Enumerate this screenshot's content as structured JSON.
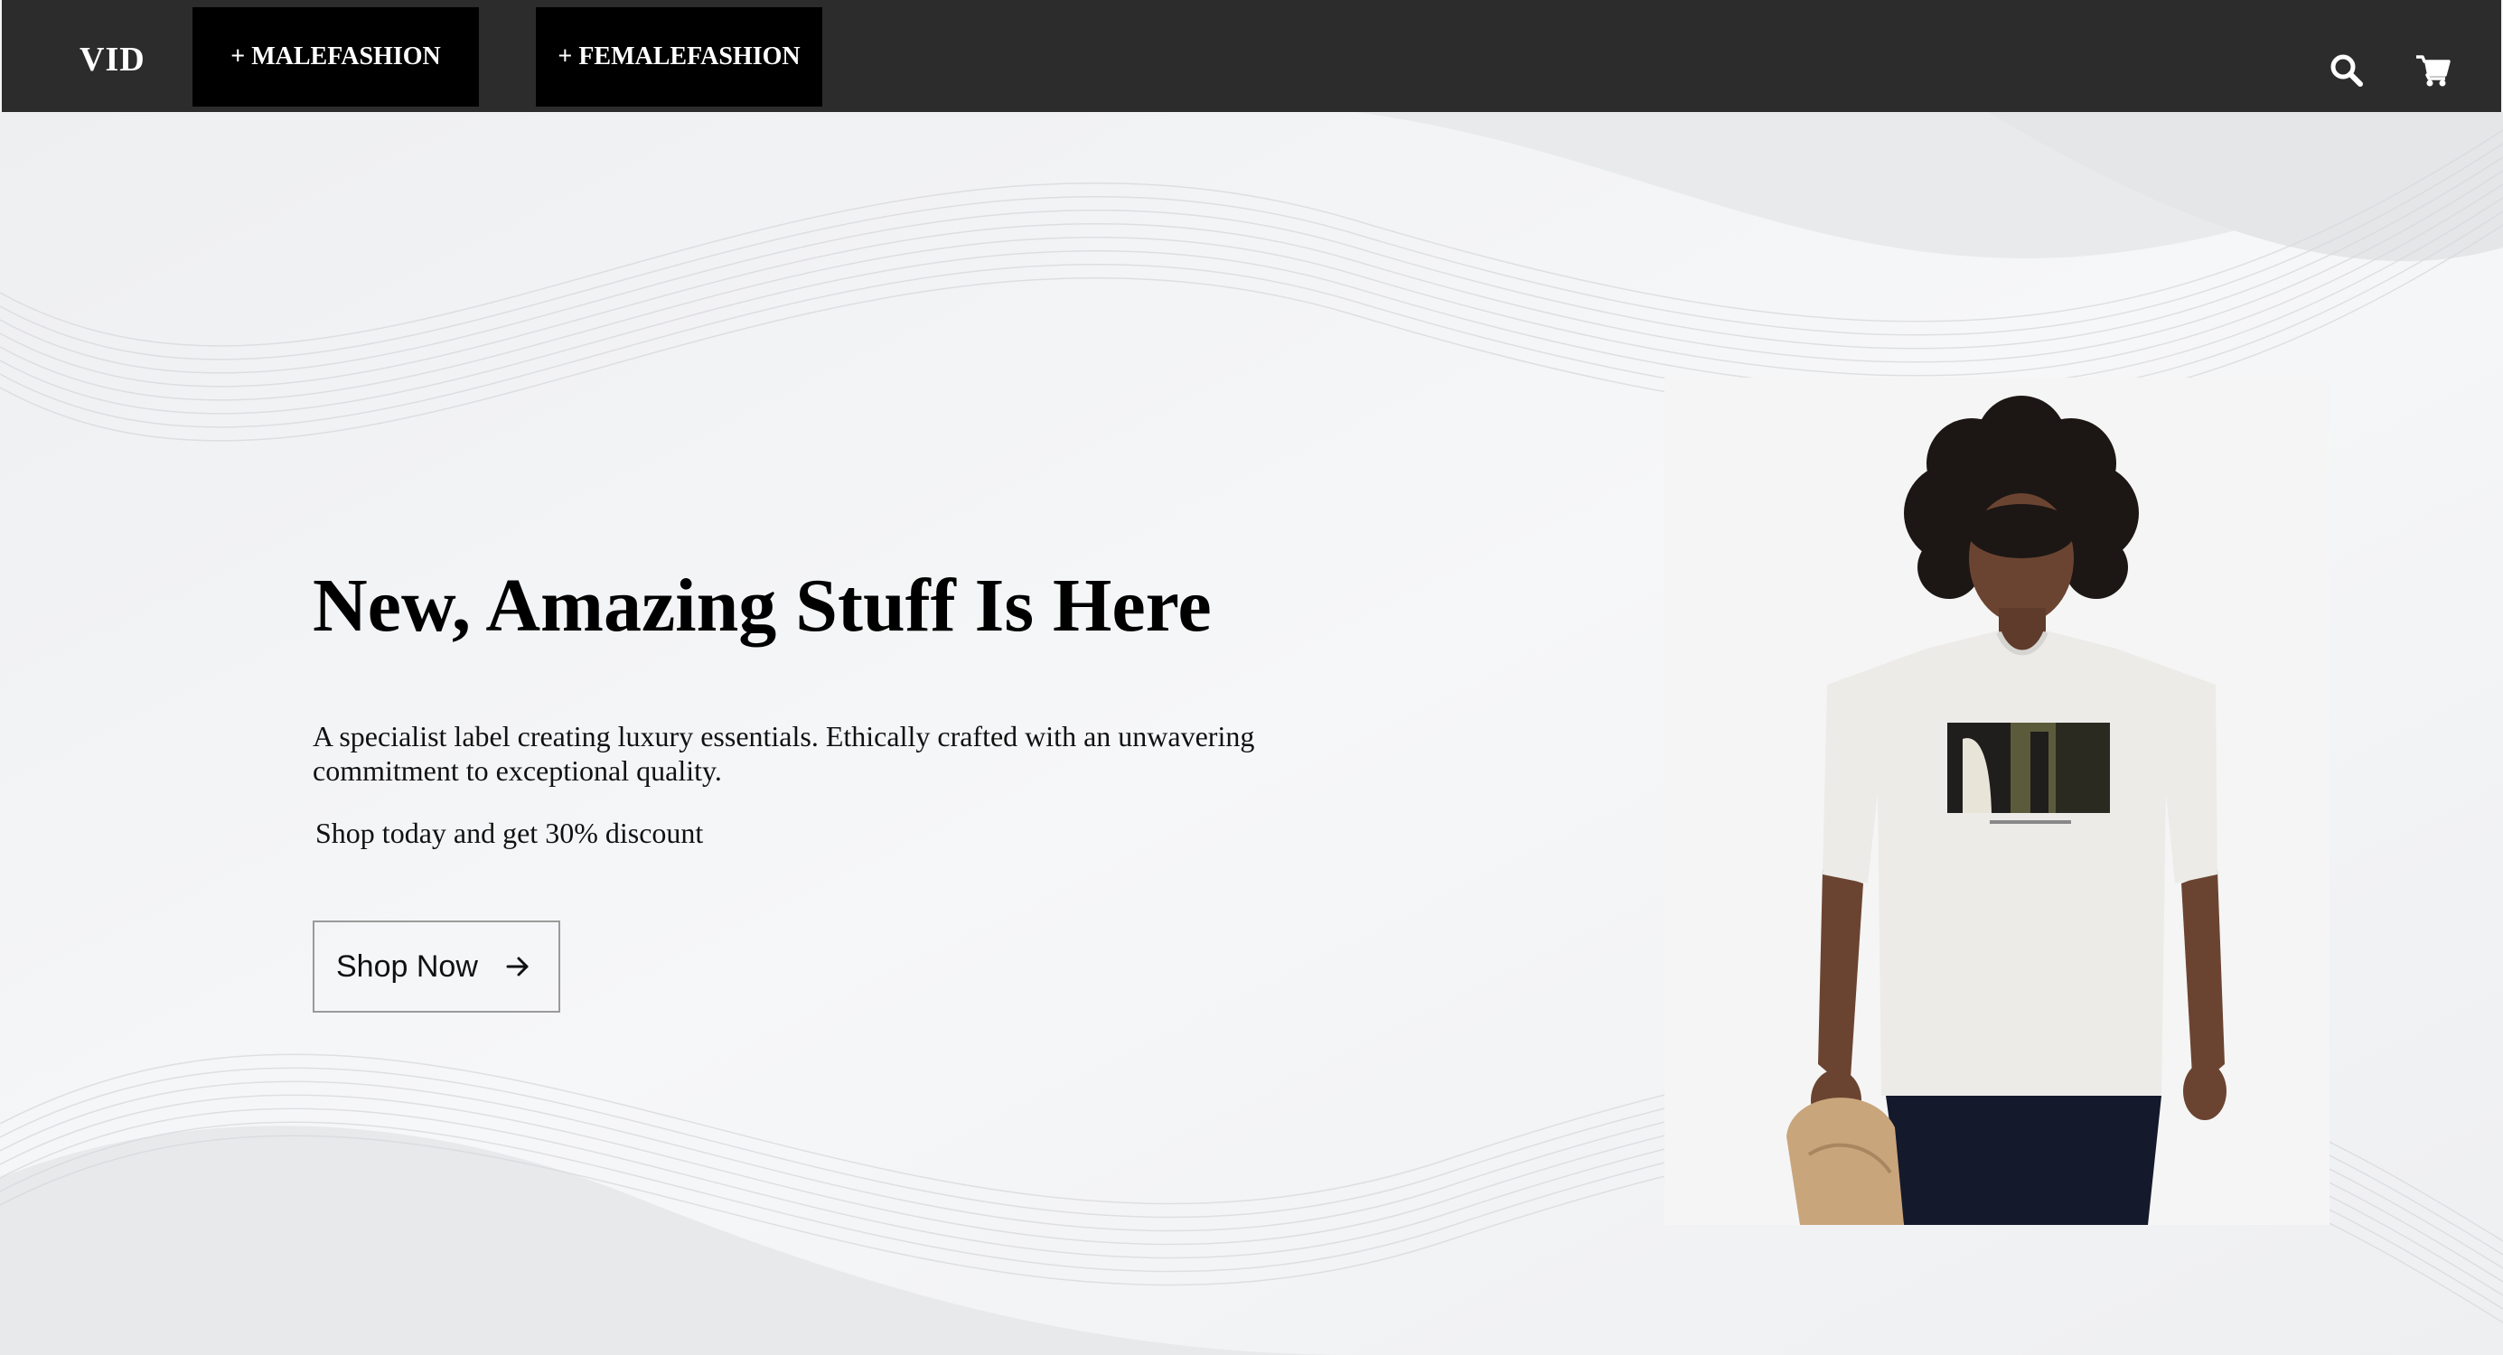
{
  "nav": {
    "logo": "VID",
    "links": [
      {
        "label": "+ MALEFASHION"
      },
      {
        "label": "+ FEMALEFASHION"
      }
    ],
    "icons": [
      "search-icon",
      "cart-icon"
    ]
  },
  "hero": {
    "headline": "New, Amazing Stuff Is Here",
    "description": "A specialist label creating luxury essentials. Ethically crafted with an unwavering commitment to exceptional quality.",
    "promo": "Shop today and get 30% discount",
    "cta_label": "Shop Now"
  },
  "colors": {
    "nav_bg": "#2c2c2c",
    "nav_button_bg": "#000000",
    "page_bg": "#f3f4f6",
    "text": "#000000"
  }
}
